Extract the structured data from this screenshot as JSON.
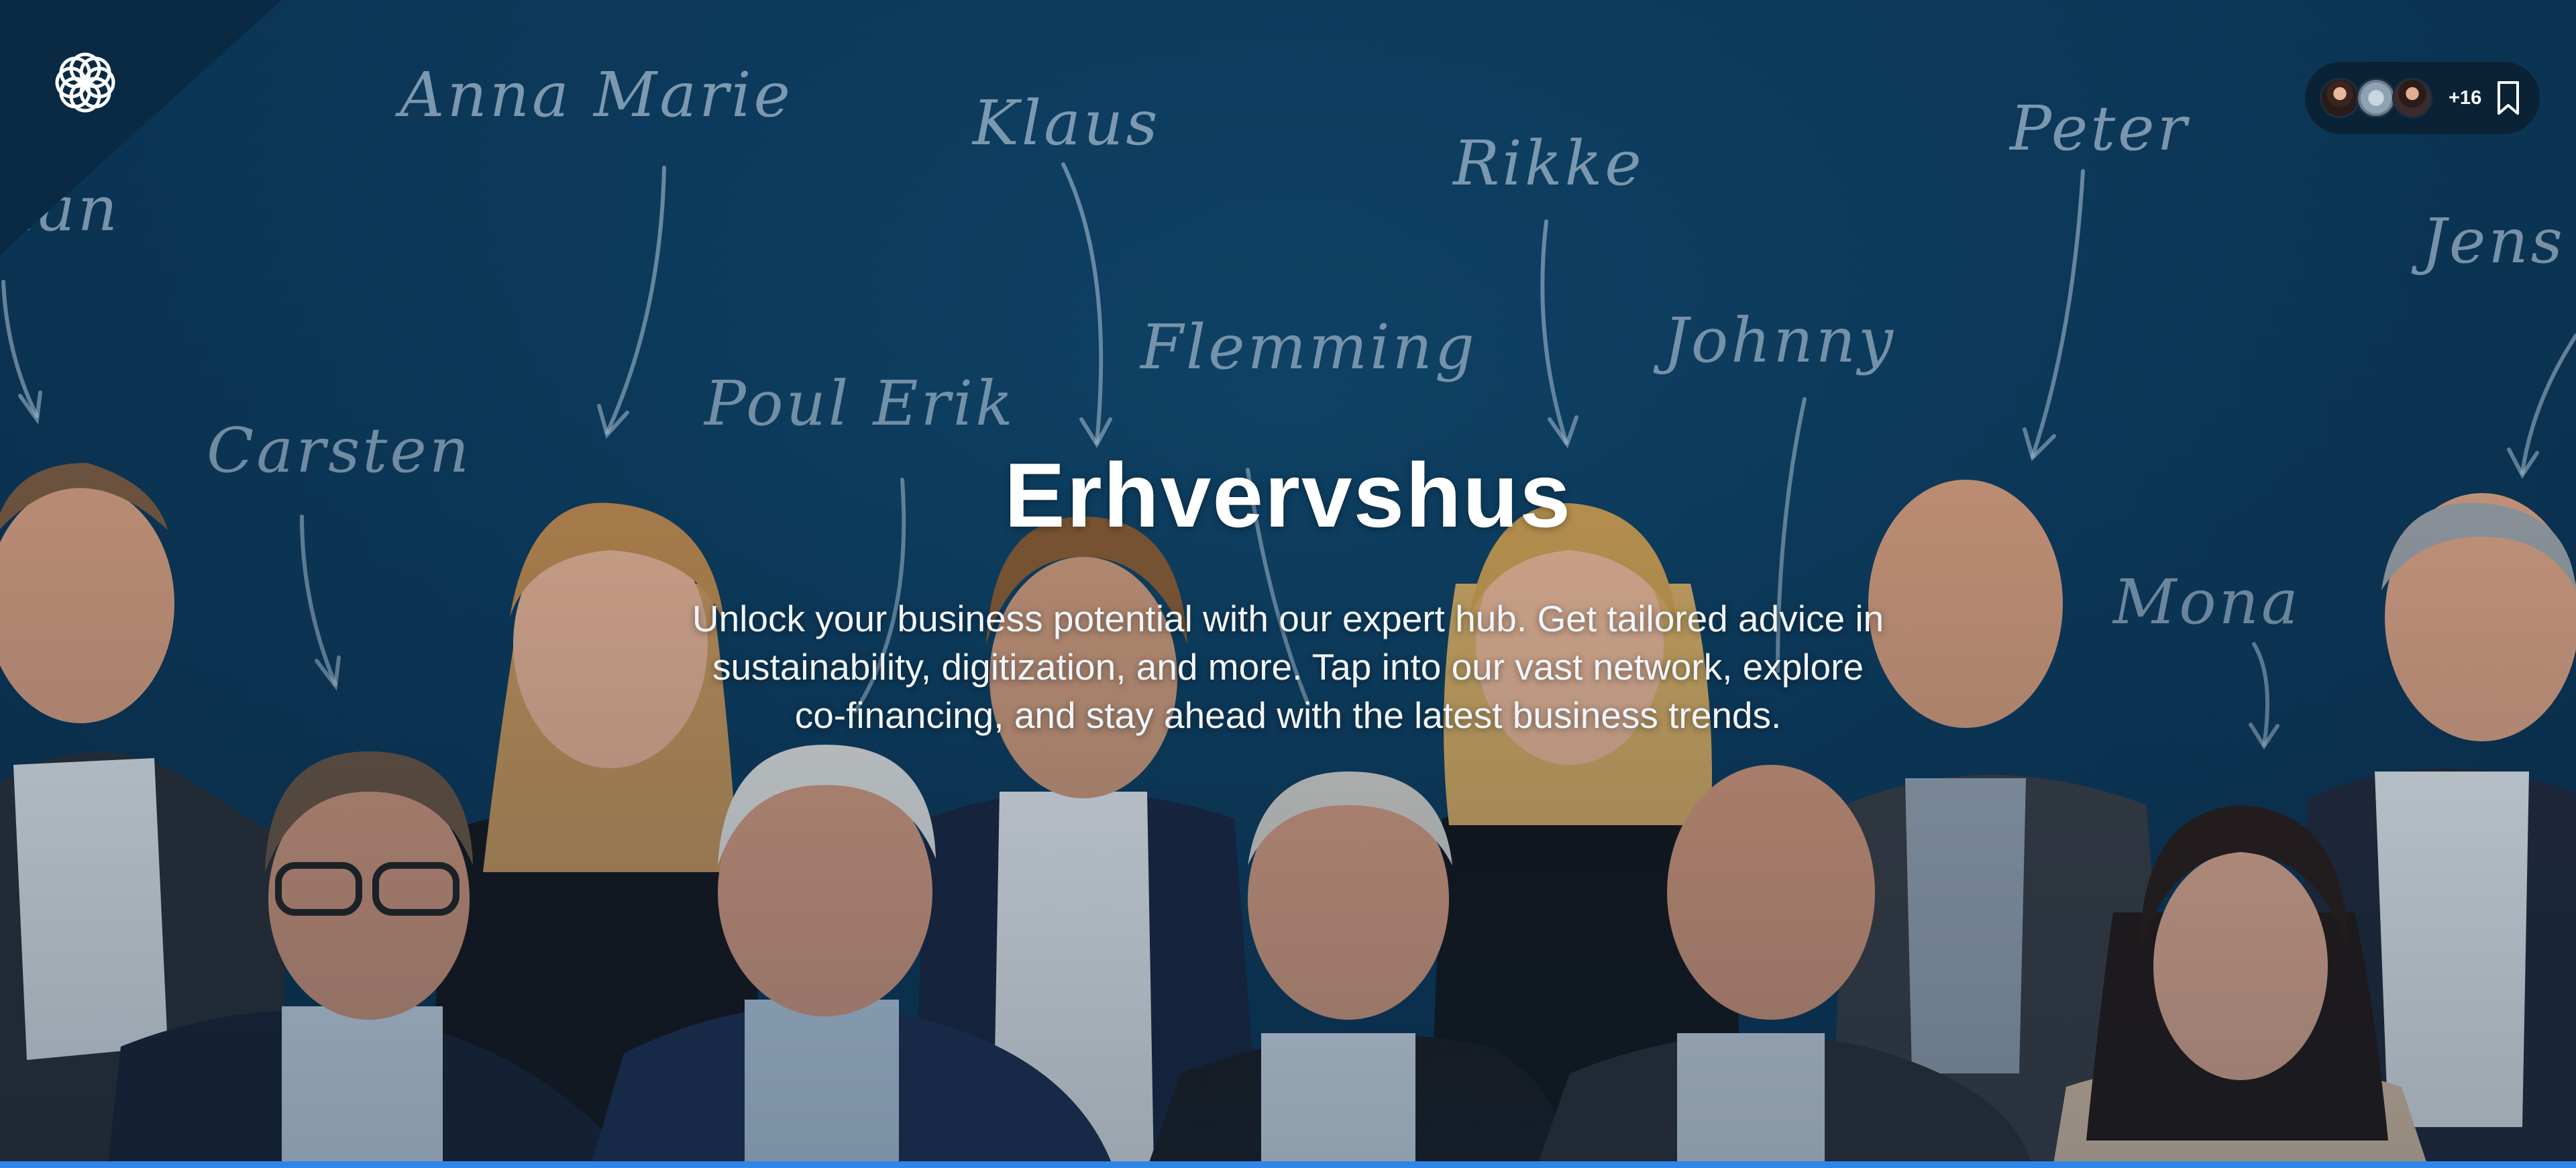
{
  "hero": {
    "title": "Erhvervshus",
    "description": "Unlock your business potential with our expert hub. Get tailored advice in sustainability, digitization, and more. Tap into our vast network, explore co-financing, and stay ahead with the latest business trends."
  },
  "names": [
    "llan",
    "Anna Marie",
    "Klaus",
    "Rikke",
    "Peter",
    "Jens",
    "Carsten",
    "Poul Erik",
    "Flemming",
    "Johnny",
    "Mona"
  ],
  "contributors": {
    "more_count": "+16",
    "avatars": [
      "avatar-woman-dark-hair",
      "avatar-illustrated",
      "avatar-woman-dark-hair-2"
    ]
  },
  "icons": {
    "logo": "flower-logo-icon",
    "bookmark": "bookmark-icon"
  },
  "colors": {
    "background": "#0c3a5c",
    "accent_bar": "#2f86e8",
    "text": "#ffffff"
  }
}
